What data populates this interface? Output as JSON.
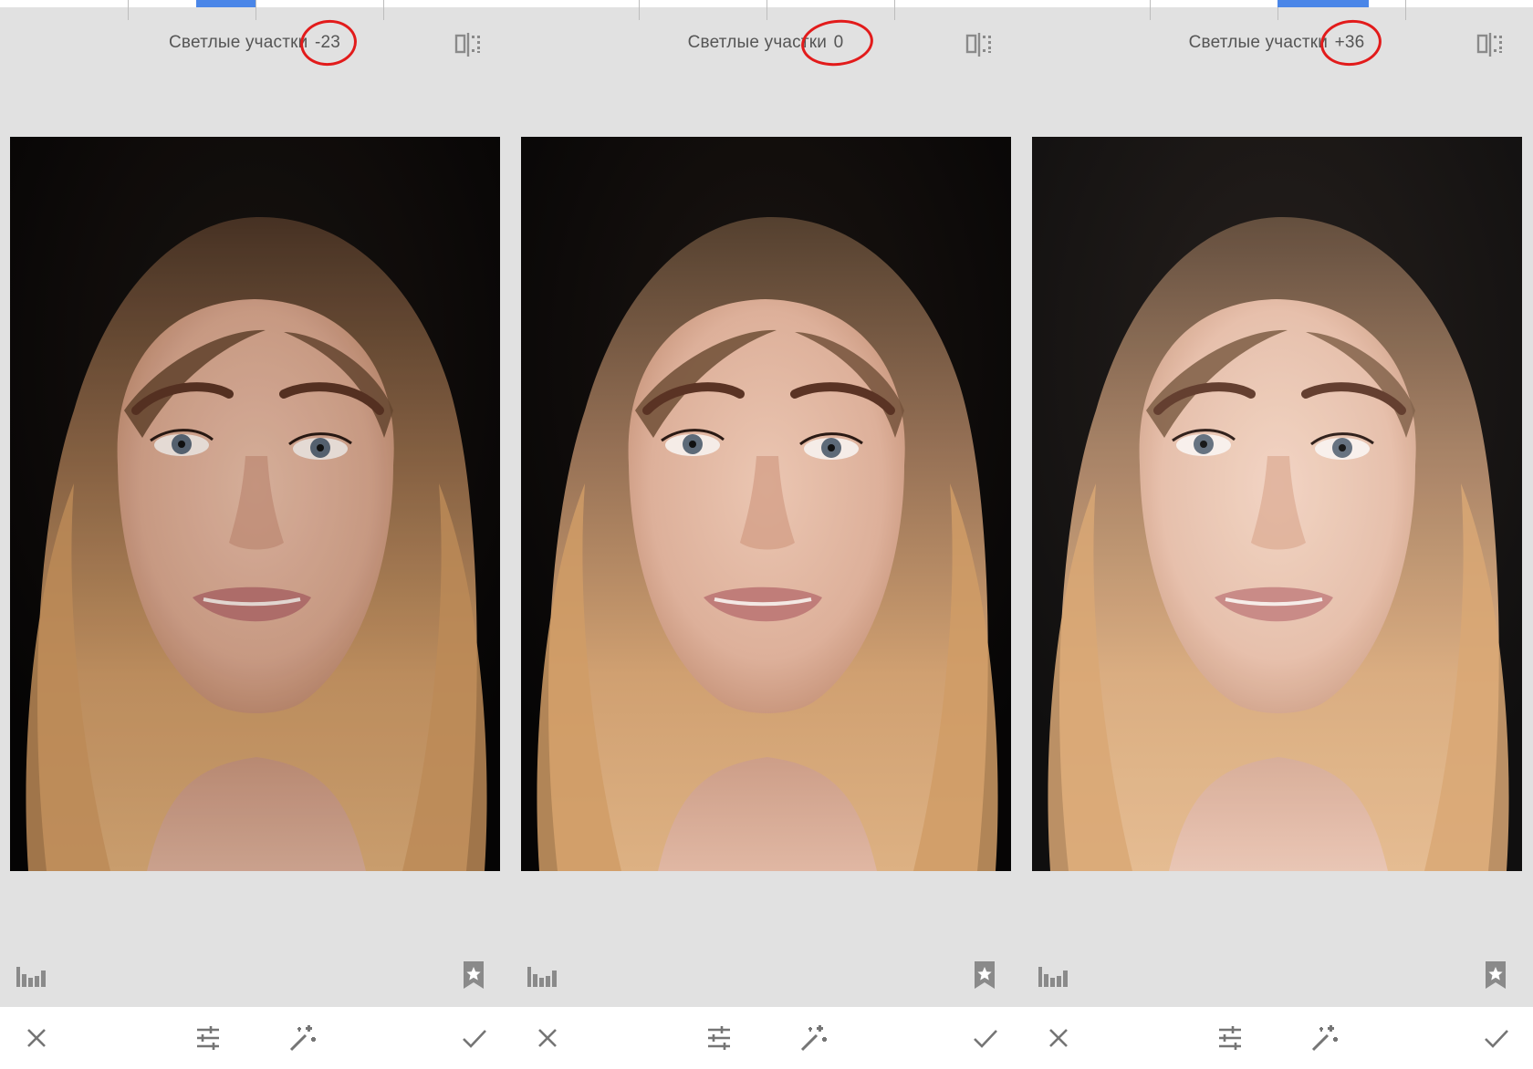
{
  "panels": [
    {
      "title_label": "Светлые участки",
      "title_value": "-23",
      "slider_level": 0.46
    },
    {
      "title_label": "Светлые участки",
      "title_value": "0",
      "slider_level": 0.5
    },
    {
      "title_label": "Светлые участки",
      "title_value": "+36",
      "slider_level": 0.58
    }
  ],
  "icons": {
    "compare": "compare-icon",
    "histogram": "histogram-icon",
    "styles": "styles-star-icon",
    "cancel": "close-icon",
    "adjust": "sliders-icon",
    "auto": "magic-wand-icon",
    "apply": "checkmark-icon"
  },
  "colors": {
    "background": "#e1e1e1",
    "accent": "#4a86e8",
    "annotation": "#e21b1b",
    "icon": "#8a8a8a"
  }
}
